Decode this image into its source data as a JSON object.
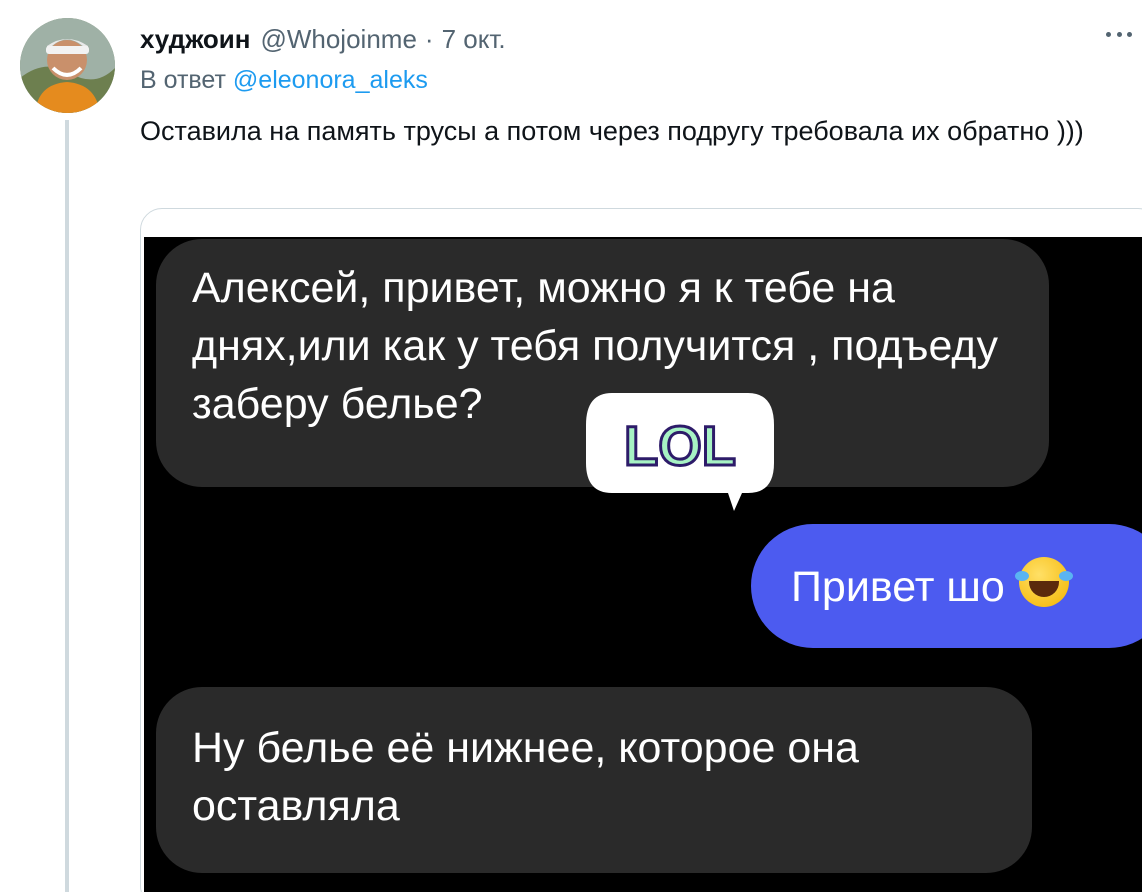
{
  "tweet": {
    "author_name": "худжоин",
    "author_handle": "@Whojoinme",
    "separator": "·",
    "date": "7 окт.",
    "reply_prefix": "В ответ",
    "reply_mention": "@eleonora_aleks",
    "text": "Оставила на память трусы а потом через подругу требовала их обратно )))"
  },
  "chat": {
    "messages": [
      {
        "side": "left",
        "text": "Алексей, привет, можно я к тебе на днях,или как у тебя получится , подъеду заберу бельe?"
      },
      {
        "side": "right",
        "text": "Привет шо",
        "emoji": "face-with-tears-of-joy"
      },
      {
        "side": "left",
        "text": "Ну белье её нижнее, которое она оставляла"
      }
    ],
    "sticker": {
      "text": "LOL"
    }
  },
  "colors": {
    "name": "#0f1419",
    "secondary": "#536471",
    "link": "#1d9bf0",
    "chat_background": "#000000",
    "incoming_bubble": "#2a2a2a",
    "outgoing_bubble": "#4c5bf0",
    "sticker_purple": "#8b5cf6",
    "sticker_green": "#a7f3c4"
  },
  "icons": {
    "more": "more-horizontal-icon",
    "avatar": "avatar"
  }
}
